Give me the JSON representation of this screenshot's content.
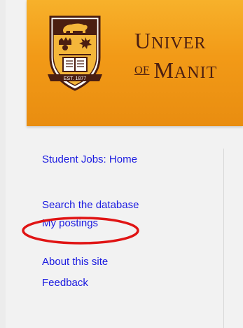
{
  "header": {
    "university_line1": "UNIVER",
    "university_line2_prefix": "OF",
    "university_line2": "MANIT",
    "crest_banner_text": "EST. 1877",
    "brand_color": "#f29a17",
    "text_color": "#4b1e11"
  },
  "sidebar": {
    "items": [
      {
        "label": "Student Jobs: Home"
      },
      {
        "label": "Search the database"
      },
      {
        "label": "My postings"
      },
      {
        "label": "About this site"
      },
      {
        "label": "Feedback"
      }
    ],
    "link_color": "#1a1ae0"
  },
  "annotation": {
    "circle_color": "#e01414",
    "target": "My postings"
  }
}
